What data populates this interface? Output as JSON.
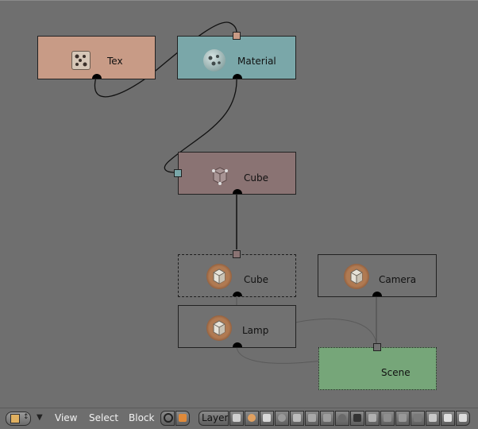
{
  "nodes": {
    "tex": {
      "label": "Tex",
      "color": "#c89b86",
      "icon": "texture-icon"
    },
    "material": {
      "label": "Material",
      "color": "#7aa7a9",
      "icon": "material-sphere-icon"
    },
    "cube_mesh": {
      "label": "Cube",
      "color": "#8a7373",
      "icon": "mesh-icon"
    },
    "cube_object": {
      "label": "Cube",
      "icon": "object-icon"
    },
    "lamp": {
      "label": "Lamp",
      "icon": "object-icon"
    },
    "camera": {
      "label": "Camera",
      "icon": "object-icon"
    },
    "scene": {
      "label": "Scene",
      "color": "#76a679"
    }
  },
  "header": {
    "menus": [
      "View",
      "Select",
      "Block"
    ],
    "layer_label": "Layer",
    "editor_type_icon": "outliner-editor-icon",
    "zoom_icon": "zoom-icon",
    "toolbar_icons": [
      "image-icon",
      "material-icon",
      "mesh-icon",
      "curve-icon",
      "lamp-icon",
      "cube-icon",
      "texture-icon",
      "world-icon",
      "scene-icon",
      "link-icon",
      "group-icon",
      "armature-icon",
      "library-icon",
      "camera-icon",
      "action-icon"
    ]
  },
  "colors": {
    "background": "#6f6f6f",
    "object_node_fill": "#717171",
    "socket_out": "#000000"
  }
}
